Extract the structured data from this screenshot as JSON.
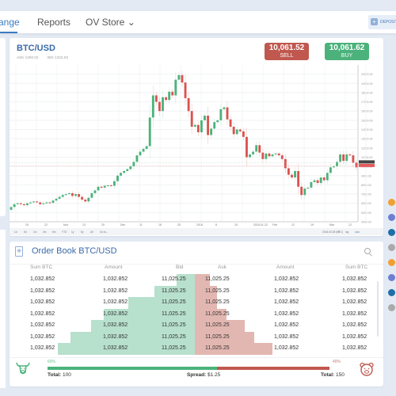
{
  "nav": {
    "tabs": [
      {
        "label": "ange",
        "active": true
      },
      {
        "label": "Reports",
        "active": false
      },
      {
        "label": "OV Store ⌄",
        "active": false
      }
    ],
    "deposit_label": "DEPOSIT",
    "deposit_icon": "plus-icon"
  },
  "chart": {
    "pair": "BTC/USD",
    "ask": "ASK 1300.02",
    "bid": "BID 1322.02",
    "sell": {
      "price": "10,061.52",
      "label": "SELL",
      "color": "#c0584f"
    },
    "buy": {
      "price": "10,061.62",
      "label": "BUY",
      "color": "#4bb27b"
    },
    "range_buttons": [
      "1d",
      "5d",
      "1m",
      "3m",
      "6m",
      "YTD",
      "1y",
      "5y",
      "All",
      "Go to..."
    ],
    "x_ticks": [
      "15",
      "22",
      "Nov",
      "13",
      "20",
      "Dec",
      "11",
      "18",
      "25",
      "2018",
      "8",
      "15",
      "2018-01-22",
      "Feb",
      "12",
      "19",
      "Mar",
      "12"
    ],
    "right_toolbar": [
      "2018-03-08 (UTC)",
      "%",
      "log",
      "auto"
    ]
  },
  "chart_data": {
    "type": "candlestick",
    "title": "BTC/USD",
    "ylim": [
      4000,
      21000
    ],
    "y_ticks": [
      20000,
      19000,
      18000,
      17000,
      16000,
      15000,
      14000,
      13000,
      12000,
      11000,
      10000,
      9000,
      8000,
      7000,
      6000,
      5000,
      4000
    ],
    "current_price": 10061.52,
    "closes": [
      5600,
      5900,
      6000,
      5900,
      5800,
      6000,
      6100,
      6200,
      6100,
      5900,
      6000,
      6100,
      6050,
      6300,
      6500,
      6700,
      6900,
      7000,
      7100,
      6800,
      7000,
      6700,
      6400,
      6200,
      6600,
      7100,
      7400,
      7800,
      7700,
      7900,
      7950,
      7900,
      8400,
      9000,
      9300,
      9500,
      9700,
      10000,
      10500,
      11200,
      11600,
      11900,
      12200,
      15300,
      17700,
      17000,
      16000,
      17500,
      17200,
      18100,
      17700,
      19400,
      19900,
      19100,
      17400,
      16000,
      14300,
      14500,
      13700,
      15000,
      15500,
      13400,
      14100,
      14800,
      15000,
      16200,
      16400,
      15100,
      14300,
      13500,
      14000,
      13800,
      13200,
      11000,
      11300,
      11600,
      12300,
      11500,
      10800,
      11400,
      11100,
      11300,
      11400,
      11200,
      10800,
      9800,
      9100,
      8800,
      9500,
      7800,
      6900,
      7600,
      7700,
      8300,
      8500,
      8200,
      8800,
      8500,
      9300,
      9900,
      10000,
      10500,
      11300,
      10600,
      11300,
      11200,
      10400,
      9900
    ],
    "series_colors": {
      "up": "#4bb27b",
      "down": "#d9534f"
    }
  },
  "orderbook": {
    "title": "Order Book BTC/USD",
    "columns": [
      "Sum BTC",
      "Amount",
      "Bid",
      "Ask",
      "Amount",
      "Sum BTC"
    ],
    "rows": [
      {
        "sum_bid": "1,032.852",
        "amount_bid": "1,032.852",
        "bid": "11,025.25",
        "ask": "11,025.25",
        "amount_ask": "1,032.852",
        "sum_ask": "1,032.852",
        "bid_depth": 0.1,
        "ask_depth": 0.08
      },
      {
        "sum_bid": "1,032.852",
        "amount_bid": "1,032.852",
        "bid": "11,025.25",
        "ask": "11,025.25",
        "amount_ask": "1,032.852",
        "sum_ask": "1,032.852",
        "bid_depth": 0.22,
        "ask_depth": 0.12
      },
      {
        "sum_bid": "1,032.852",
        "amount_bid": "1,032.852",
        "bid": "11,025.25",
        "ask": "11,025.25",
        "amount_ask": "1,032.852",
        "sum_ask": "1,032.852",
        "bid_depth": 0.36,
        "ask_depth": 0.12
      },
      {
        "sum_bid": "1,032.852",
        "amount_bid": "1,032.852",
        "bid": "11,025.25",
        "ask": "11,025.25",
        "amount_ask": "1,032.852",
        "sum_ask": "1,032.852",
        "bid_depth": 0.49,
        "ask_depth": 0.17
      },
      {
        "sum_bid": "1,032.852",
        "amount_bid": "1,032.852",
        "bid": "11,025.25",
        "ask": "11,025.25",
        "amount_ask": "1,032.852",
        "sum_ask": "1,032.852",
        "bid_depth": 0.56,
        "ask_depth": 0.27
      },
      {
        "sum_bid": "1,032.852",
        "amount_bid": "1,032.852",
        "bid": "11,025.25",
        "ask": "11,025.25",
        "amount_ask": "1,032.852",
        "sum_ask": "1,032.852",
        "bid_depth": 0.67,
        "ask_depth": 0.32
      },
      {
        "sum_bid": "1,032.852",
        "amount_bid": "1,032.852",
        "bid": "11,025.25",
        "ask": "11,025.25",
        "amount_ask": "1,032.852",
        "sum_ask": "1,032.852",
        "bid_depth": 0.74,
        "ask_depth": 0.42
      }
    ],
    "bull_pct": "60%",
    "bear_pct": "40%",
    "bull_fraction": 0.6,
    "total_bid_label": "Total:",
    "total_bid": "100",
    "spread_label": "Spread:",
    "spread": "$1.25",
    "total_ask_label": "Total:",
    "total_ask": "150"
  },
  "right_panel": {
    "coins": [
      {
        "icon": "bitcoin-icon",
        "color": "#f0a033"
      },
      {
        "icon": "ethereum-icon",
        "color": "#6c7fd1"
      },
      {
        "icon": "ripple-icon",
        "color": "#1f6fa8"
      },
      {
        "icon": "litecoin-icon",
        "color": "#aaaaaa"
      },
      {
        "icon": "bitcoin-icon",
        "color": "#f0a033"
      },
      {
        "icon": "ethereum-icon",
        "color": "#6c7fd1"
      },
      {
        "icon": "ripple-icon",
        "color": "#1f6fa8"
      },
      {
        "icon": "litecoin-icon",
        "color": "#aaaaaa"
      }
    ]
  }
}
